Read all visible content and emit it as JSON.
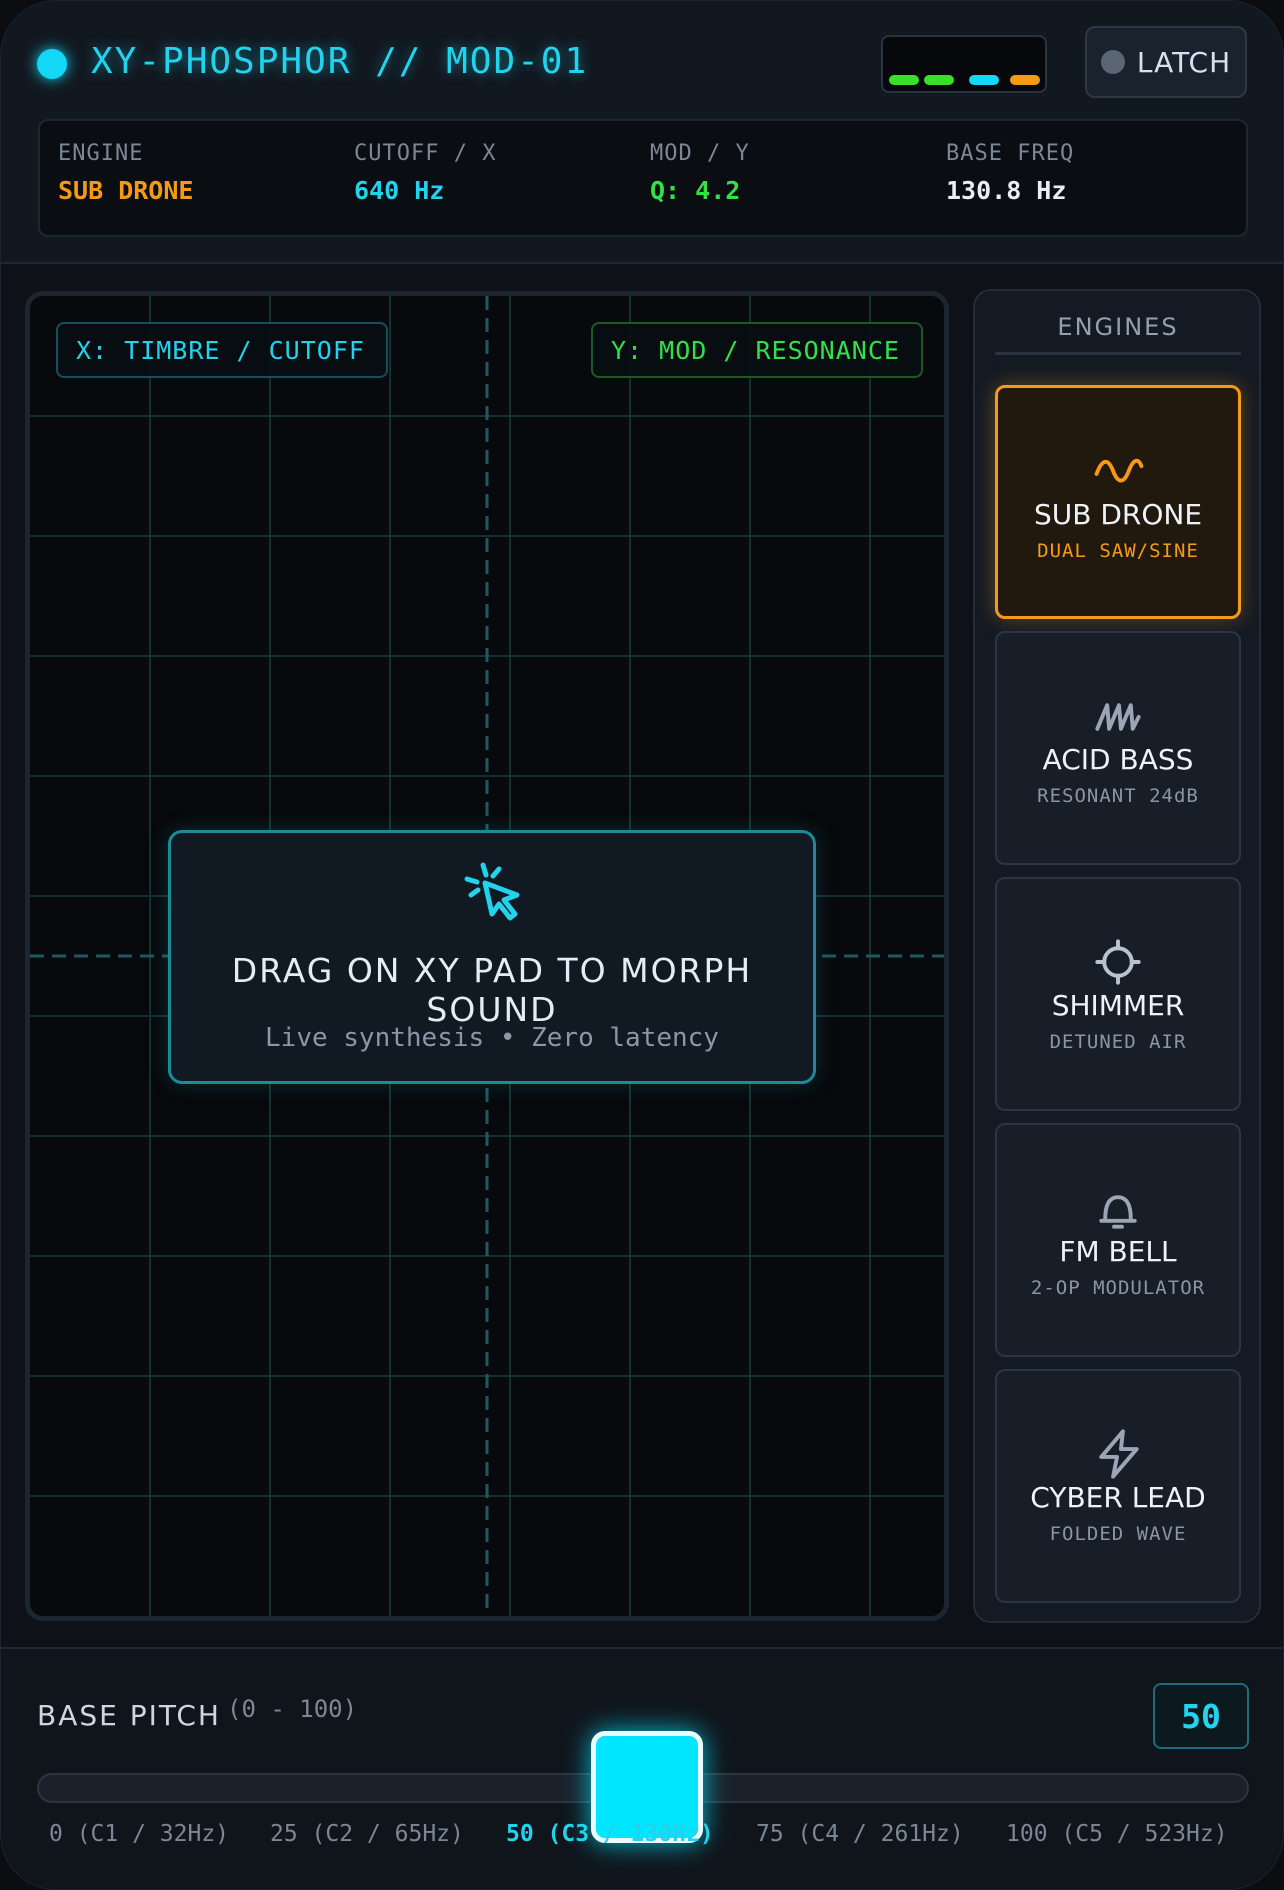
{
  "header": {
    "title": "XY-PHOSPHOR // MOD-01",
    "latch_label": "LATCH",
    "meter_colors": [
      "#39e02a",
      "#39e02a",
      "#12d8f5",
      "#f59a16"
    ]
  },
  "status": {
    "engine": {
      "label": "ENGINE",
      "value": "SUB DRONE",
      "color": "#f59a16"
    },
    "cutoff": {
      "label": "CUTOFF / X",
      "value": "640 Hz",
      "color": "#22d3ee"
    },
    "mod": {
      "label": "MOD / Y",
      "value": "Q: 4.2",
      "color": "#34e04a"
    },
    "freq": {
      "label": "BASE FREQ",
      "value": "130.8 Hz",
      "color": "#e8eef5"
    }
  },
  "pad": {
    "x_axis_label": "X: TIMBRE / CUTOFF",
    "y_axis_label": "Y: MOD / RESONANCE",
    "hint_title": "DRAG ON XY PAD TO MORPH SOUND",
    "hint_subtitle": "Live synthesis • Zero latency"
  },
  "engines": {
    "heading": "ENGINES",
    "items": [
      {
        "name": "SUB DRONE",
        "desc": "DUAL SAW/SINE",
        "icon": "sine-wave-icon",
        "active": true
      },
      {
        "name": "ACID BASS",
        "desc": "RESONANT 24dB",
        "icon": "sawtooth-wave-icon",
        "active": false
      },
      {
        "name": "SHIMMER",
        "desc": "DETUNED AIR",
        "icon": "crosshair-icon",
        "active": false
      },
      {
        "name": "FM BELL",
        "desc": "2-OP MODULATOR",
        "icon": "bell-icon",
        "active": false
      },
      {
        "name": "CYBER LEAD",
        "desc": "FOLDED WAVE",
        "icon": "lightning-icon",
        "active": false
      }
    ]
  },
  "pitch": {
    "label": "BASE PITCH",
    "range": "(0 - 100)",
    "value": "50",
    "ticks": [
      "0 (C1 / 32Hz)",
      "25 (C2 / 65Hz)",
      "50 (C3 / 130Hz)",
      "75 (C4 / 261Hz)",
      "100 (C5 / 523Hz)"
    ]
  }
}
